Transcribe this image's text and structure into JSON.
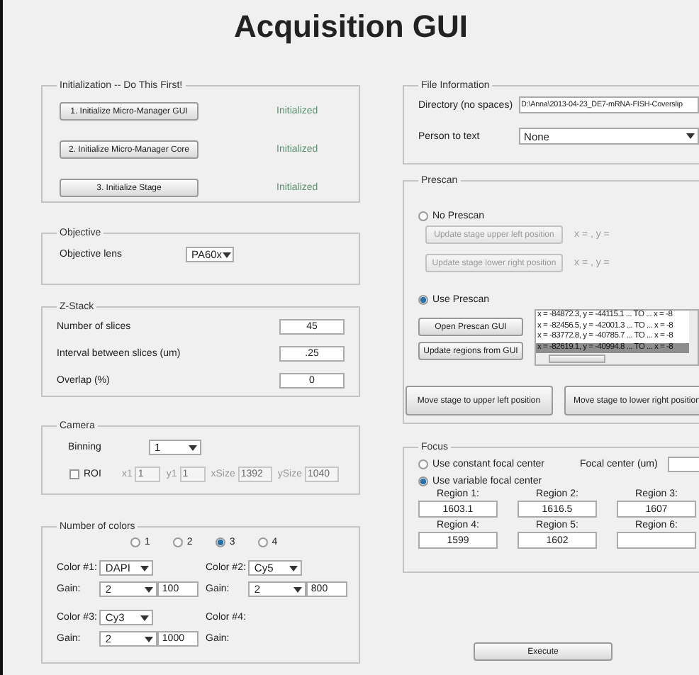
{
  "window": {
    "title": "Acquisition GUI"
  },
  "initialization": {
    "title": "Initialization -- Do This First!",
    "steps": [
      {
        "button": "1. Initialize Micro-Manager GUI",
        "status": "Initialized"
      },
      {
        "button": "2. Initialize Micro-Manager Core",
        "status": "Initialized"
      },
      {
        "button": "3. Initialize Stage",
        "status": "Initialized"
      }
    ]
  },
  "objective": {
    "title": "Objective",
    "label": "Objective lens",
    "value": "PA60x"
  },
  "z_stack": {
    "title": "Z-Stack",
    "fields": [
      {
        "label": "Number of slices",
        "value": "45"
      },
      {
        "label": "Interval between slices (um)",
        "value": ".25"
      },
      {
        "label": "Overlap (%)",
        "value": "0"
      }
    ]
  },
  "camera": {
    "title": "Camera",
    "binning": {
      "label": "Binning",
      "value": "1"
    },
    "roi": {
      "label": "ROI",
      "checked": false,
      "fields": [
        {
          "label": "x1",
          "value": "1"
        },
        {
          "label": "y1",
          "value": "1"
        },
        {
          "label": "xSize",
          "value": "1392"
        },
        {
          "label": "ySize",
          "value": "1040"
        }
      ]
    }
  },
  "number_of_colors": {
    "title": "Number of colors",
    "options": [
      {
        "label": "1",
        "selected": false
      },
      {
        "label": "2",
        "selected": false
      },
      {
        "label": "3",
        "selected": true
      },
      {
        "label": "4",
        "selected": false
      }
    ],
    "colors": [
      {
        "label": "Color #1:",
        "value": "DAPI",
        "gain_label": "Gain:",
        "gain": "2",
        "exposure": "100"
      },
      {
        "label": "Color #2:",
        "value": "Cy5",
        "gain_label": "Gain:",
        "gain": "2",
        "exposure": "800"
      },
      {
        "label": "Color #3:",
        "value": "Cy3",
        "gain_label": "Gain:",
        "gain": "2",
        "exposure": "1000"
      },
      {
        "label": "Color #4:",
        "gain_label": "Gain:"
      }
    ]
  },
  "file_information": {
    "title": "File Information",
    "directory": {
      "label": "Directory (no spaces)",
      "value": "D:\\Anna\\2013-04-23_DE7-mRNA-FISH-Coverslip"
    },
    "person": {
      "label": "Person to text",
      "value": "None"
    }
  },
  "prescan": {
    "title": "Prescan",
    "modes": [
      {
        "label": "No Prescan",
        "selected": false
      },
      {
        "label": "Use Prescan",
        "selected": true
      }
    ],
    "position_buttons": [
      {
        "label": "Update stage upper left position",
        "reading": "x = , y ="
      },
      {
        "label": "Update stage lower right position",
        "reading": "x = , y ="
      }
    ],
    "gui_buttons": [
      "Open Prescan GUI",
      "Update regions from GUI"
    ],
    "regions": [
      {
        "text": "x = -84872.3, y = -44115.1 ... TO ... x = -8",
        "selected": false
      },
      {
        "text": "x = -82456.5, y = -42001.3 ... TO ... x = -8",
        "selected": false
      },
      {
        "text": "x = -83772.8, y = -40785.7 ... TO ... x = -8",
        "selected": false
      },
      {
        "text": "x = -82619.1, y = -40994.8 ... TO ... x = -8",
        "selected": true
      }
    ],
    "move_buttons": [
      "Move stage to upper left position",
      "Move stage to lower right position"
    ]
  },
  "focus": {
    "title": "Focus",
    "modes": [
      {
        "label": "Use constant focal center",
        "selected": false
      },
      {
        "label": "Use variable focal center",
        "selected": true
      }
    ],
    "focal_center": {
      "label": "Focal center (um)"
    },
    "regions": [
      {
        "label": "Region 1:",
        "value": "1603.1"
      },
      {
        "label": "Region 2:",
        "value": "1616.5"
      },
      {
        "label": "Region 3:",
        "value": "1607"
      },
      {
        "label": "Region 4:",
        "value": "1599"
      },
      {
        "label": "Region 5:",
        "value": "1602"
      },
      {
        "label": "Region 6:"
      }
    ]
  },
  "execute_button": "Execute"
}
